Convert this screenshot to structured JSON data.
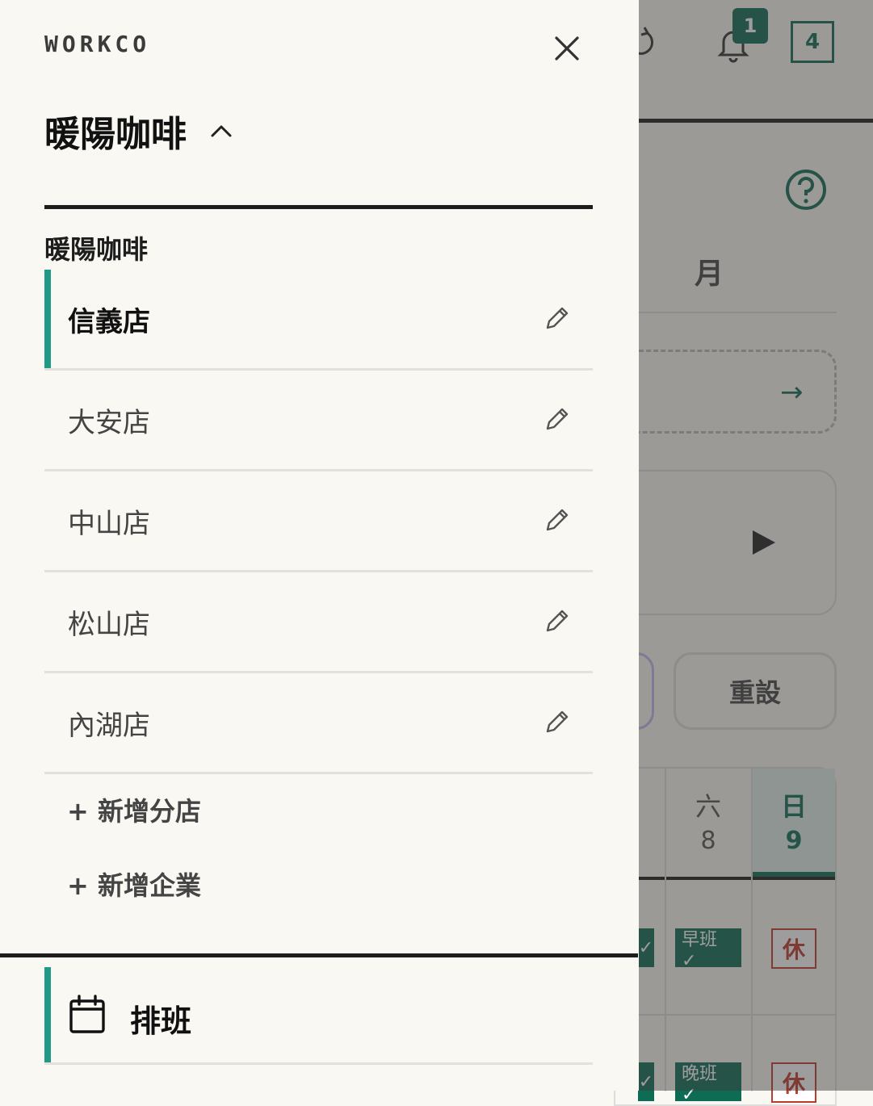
{
  "background": {
    "notification_count": "1",
    "counter_value": "4",
    "month_tab": "月",
    "reset_label": "重設",
    "days": [
      {
        "name": "六",
        "num": "8"
      },
      {
        "name": "日",
        "num": "9"
      }
    ],
    "shift_tags": [
      "早班 ✓",
      "晚班 ✓"
    ],
    "off_label": "休",
    "partial_check": "✓"
  },
  "drawer": {
    "brand": "WORKCO",
    "org_title": "暖陽咖啡",
    "section_label": "暖陽咖啡",
    "branches": [
      {
        "label": "信義店",
        "active": true
      },
      {
        "label": "大安店",
        "active": false
      },
      {
        "label": "中山店",
        "active": false
      },
      {
        "label": "松山店",
        "active": false
      },
      {
        "label": "內湖店",
        "active": false
      }
    ],
    "add_branch": "+ 新增分店",
    "add_company": "+ 新增企業",
    "nav": {
      "label": "排班",
      "icon": "calendar-icon"
    }
  },
  "colors": {
    "accent": "#1f9a86",
    "brand_green": "#0e6b54",
    "off_red": "#c0392b",
    "background": "#faf8f3"
  }
}
